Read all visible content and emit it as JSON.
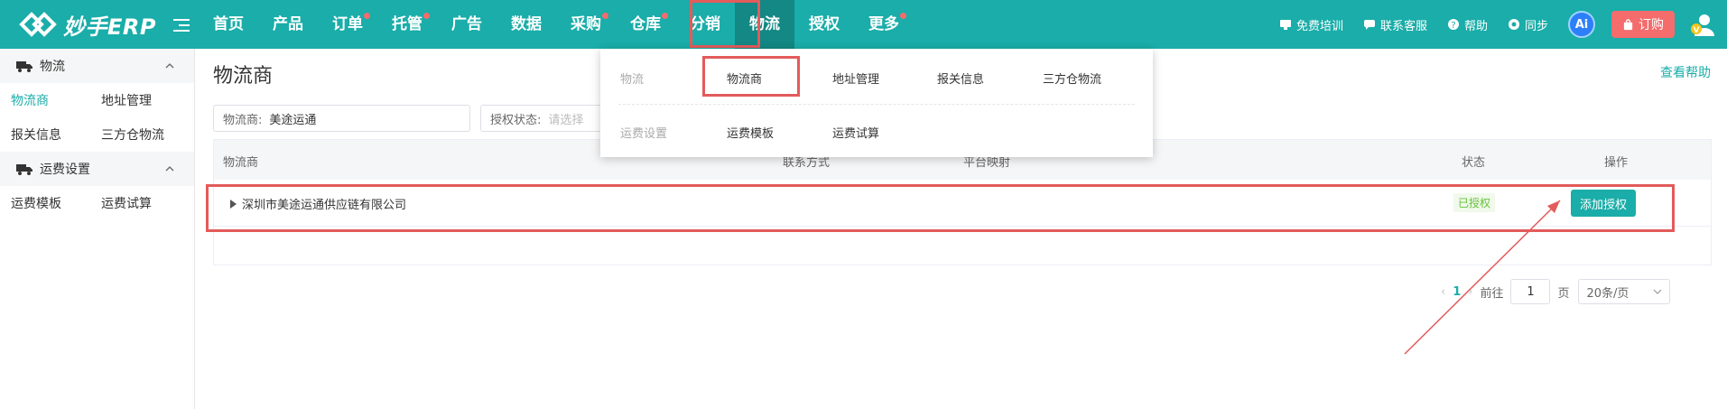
{
  "app": {
    "logo_text": "妙手ERP"
  },
  "nav": {
    "items": [
      {
        "label": "首页",
        "dot": false
      },
      {
        "label": "产品",
        "dot": false
      },
      {
        "label": "订单",
        "dot": true
      },
      {
        "label": "托管",
        "dot": true
      },
      {
        "label": "广告",
        "dot": false
      },
      {
        "label": "数据",
        "dot": false
      },
      {
        "label": "采购",
        "dot": true
      },
      {
        "label": "仓库",
        "dot": true
      },
      {
        "label": "分销",
        "dot": false
      },
      {
        "label": "物流",
        "dot": false,
        "active": true
      },
      {
        "label": "授权",
        "dot": false
      },
      {
        "label": "更多",
        "dot": true
      }
    ],
    "tools": [
      {
        "label": "免费培训",
        "icon": "training-icon"
      },
      {
        "label": "联系客服",
        "icon": "chat-icon"
      },
      {
        "label": "帮助",
        "icon": "question-icon"
      },
      {
        "label": "同步",
        "icon": "sync-icon"
      }
    ],
    "ai_label": "Ai",
    "order_button": "订购"
  },
  "dropdown": {
    "row1": {
      "category": "物流",
      "items": [
        "物流商",
        "地址管理",
        "报关信息",
        "三方仓物流"
      ]
    },
    "row2": {
      "category": "运费设置",
      "items": [
        "运费模板",
        "运费试算"
      ]
    }
  },
  "sidebar": {
    "group1": {
      "label": "物流",
      "links": [
        "物流商",
        "地址管理",
        "报关信息",
        "三方仓物流"
      ]
    },
    "group2": {
      "label": "运费设置",
      "links": [
        "运费模板",
        "运费试算"
      ]
    }
  },
  "main": {
    "title": "物流商",
    "help": "查看帮助",
    "filter_carrier": {
      "label": "物流商:",
      "value": "美途运通"
    },
    "filter_status": {
      "label": "授权状态:",
      "placeholder": "请选择"
    },
    "table": {
      "headers": [
        "物流商",
        "联系方式",
        "平台映射",
        "状态",
        "操作"
      ],
      "rows": [
        {
          "name": "深圳市美途运通供应链有限公司",
          "status": "已授权",
          "action": "添加授权"
        }
      ]
    },
    "pager": {
      "current_page": "1",
      "goto_label": "前往",
      "goto_value": "1",
      "page_suffix": "页",
      "page_size": "20条/页"
    }
  },
  "colors": {
    "brand": "#1aada9",
    "accent_red": "#e35b5b",
    "order": "#f56c6c",
    "success": "#67c23a"
  }
}
